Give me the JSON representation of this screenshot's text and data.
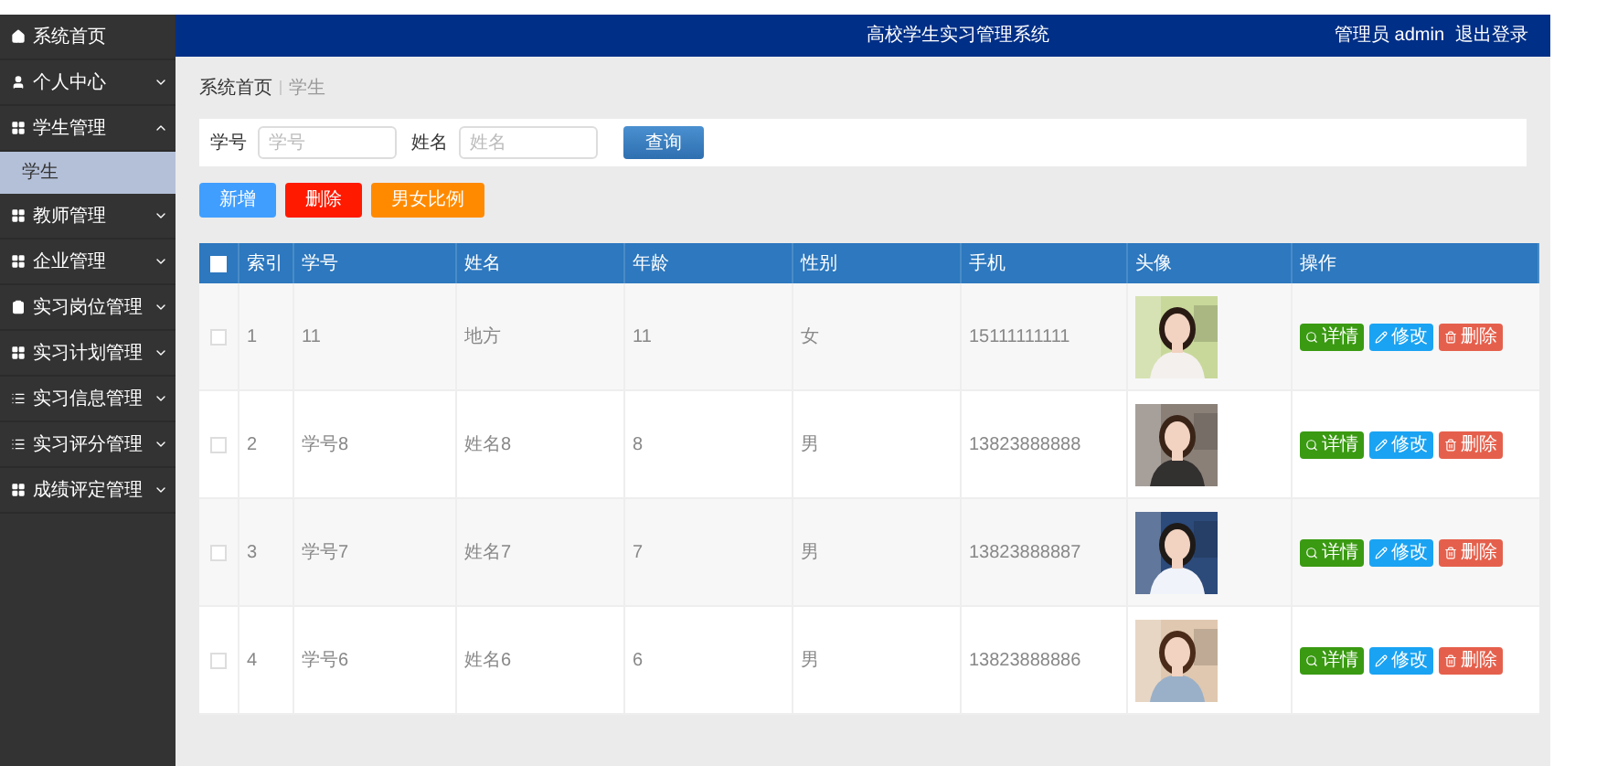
{
  "sidebar": {
    "items": [
      {
        "label": "系统首页",
        "has_children": false
      },
      {
        "label": "个人中心",
        "expanded": false,
        "has_children": true
      },
      {
        "label": "学生管理",
        "expanded": true,
        "has_children": true,
        "children": [
          {
            "label": "学生",
            "selected": true
          }
        ]
      },
      {
        "label": "教师管理",
        "expanded": false,
        "has_children": true
      },
      {
        "label": "企业管理",
        "expanded": false,
        "has_children": true
      },
      {
        "label": "实习岗位管理",
        "expanded": false,
        "has_children": true
      },
      {
        "label": "实习计划管理",
        "expanded": false,
        "has_children": true
      },
      {
        "label": "实习信息管理",
        "expanded": false,
        "has_children": true
      },
      {
        "label": "实习评分管理",
        "expanded": false,
        "has_children": true
      },
      {
        "label": "成绩评定管理",
        "expanded": false,
        "has_children": true
      }
    ]
  },
  "header": {
    "title": "高校学生实习管理系统",
    "user": "管理员 admin",
    "logout": "退出登录"
  },
  "breadcrumb": [
    "系统首页",
    "学生"
  ],
  "search": {
    "fields": [
      {
        "label": "学号",
        "placeholder": "学号"
      },
      {
        "label": "姓名",
        "placeholder": "姓名"
      }
    ],
    "button": "查询"
  },
  "toolbar": [
    {
      "label": "新增",
      "kind": "add"
    },
    {
      "label": "删除",
      "kind": "delete"
    },
    {
      "label": "男女比例",
      "kind": "chart"
    }
  ],
  "table": {
    "select_all_checked": false,
    "columns": [
      "索引",
      "学号",
      "姓名",
      "年龄",
      "性别",
      "手机",
      "头像",
      "操作"
    ],
    "rows": [
      {
        "checked": false,
        "cells": [
          "1",
          "11",
          "地方",
          "11",
          "女",
          "15111111111"
        ],
        "actions": [
          {
            "label": "详情",
            "kind": "view"
          },
          {
            "label": "修改",
            "kind": "edit"
          },
          {
            "label": "删除",
            "kind": "delete"
          }
        ]
      },
      {
        "checked": false,
        "cells": [
          "2",
          "学号8",
          "姓名8",
          "8",
          "男",
          "13823888888"
        ],
        "actions": [
          {
            "label": "详情",
            "kind": "view"
          },
          {
            "label": "修改",
            "kind": "edit"
          },
          {
            "label": "删除",
            "kind": "delete"
          }
        ]
      },
      {
        "checked": false,
        "cells": [
          "3",
          "学号7",
          "姓名7",
          "7",
          "男",
          "13823888887"
        ],
        "actions": [
          {
            "label": "详情",
            "kind": "view"
          },
          {
            "label": "修改",
            "kind": "edit"
          },
          {
            "label": "删除",
            "kind": "delete"
          }
        ]
      },
      {
        "checked": false,
        "cells": [
          "4",
          "学号6",
          "姓名6",
          "6",
          "男",
          "13823888886"
        ],
        "actions": [
          {
            "label": "详情",
            "kind": "view"
          },
          {
            "label": "修改",
            "kind": "edit"
          },
          {
            "label": "删除",
            "kind": "delete"
          }
        ]
      }
    ]
  }
}
